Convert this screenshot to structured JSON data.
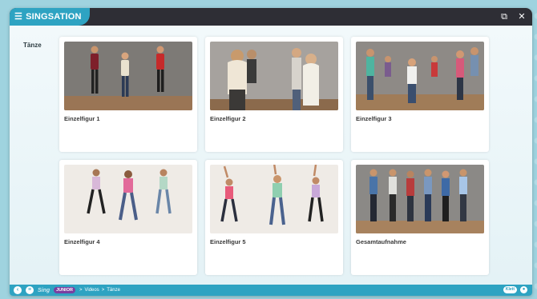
{
  "app": {
    "title": "SINGSATION",
    "menu_icon": "menu-icon",
    "window_icons": [
      "restore-icon",
      "close-icon"
    ]
  },
  "section": {
    "title": "Tänze"
  },
  "videos": [
    {
      "label": "Einzelfigur 1"
    },
    {
      "label": "Einzelfigur 2"
    },
    {
      "label": "Einzelfigur 3"
    },
    {
      "label": "Einzelfigur 4"
    },
    {
      "label": "Einzelfigur 5"
    },
    {
      "label": "Gesamtaufnahme"
    }
  ],
  "footer": {
    "logo": "Sing",
    "badge": "JUNIOR",
    "breadcrumb": [
      "Videos",
      "Tänze"
    ],
    "right_pill": "Klett"
  },
  "colors": {
    "accent": "#2ea3c2",
    "titlebar": "#2e2e35",
    "badge": "#7a3fa0"
  }
}
